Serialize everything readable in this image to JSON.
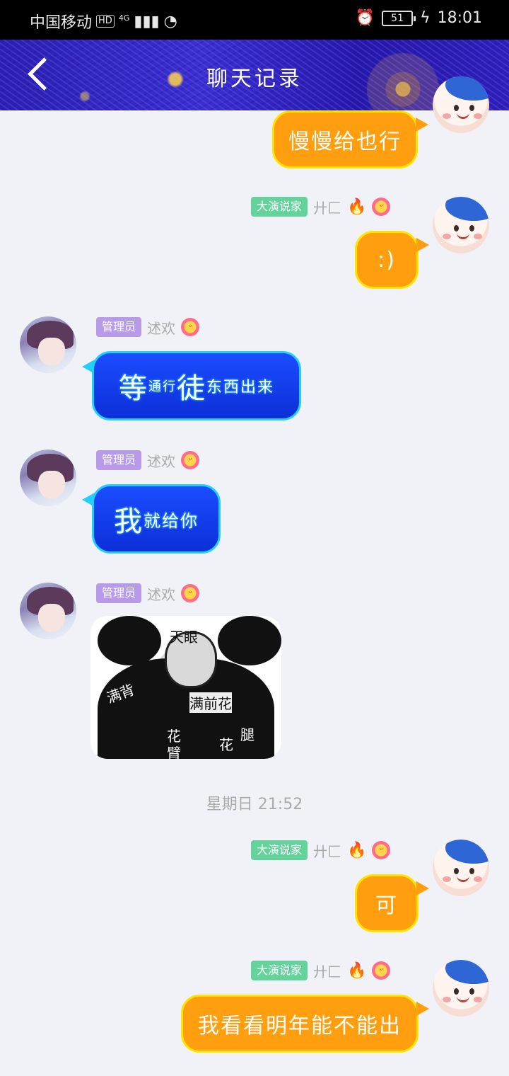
{
  "status_bar": {
    "carrier": "中国移动",
    "hd_badge": "HD",
    "network": "4G",
    "battery": "51",
    "time": "18:01"
  },
  "header": {
    "title": "聊天记录"
  },
  "messages": [
    {
      "sender": "self",
      "text": "慢慢给也行"
    },
    {
      "sender": "self",
      "tag": "大演说家",
      "nick": "廾匚",
      "text": ":)"
    },
    {
      "sender": "other",
      "tag": "管理员",
      "nick": "述欢",
      "text_big1": "等",
      "text_small1": "通行",
      "text_big2": "徒",
      "text_small2": "东西出来"
    },
    {
      "sender": "other",
      "tag": "管理员",
      "nick": "述欢",
      "text_big": "我",
      "text_small": "就给你"
    },
    {
      "sender": "other",
      "tag": "管理员",
      "nick": "述欢",
      "sticker": {
        "top": "天眼",
        "left": "满背",
        "right": "满前花",
        "label1": "花",
        "label2": "臂",
        "label3": "花",
        "label4": "腿"
      }
    },
    {
      "sender": "self",
      "tag": "大演说家",
      "nick": "廾匚",
      "text": "可"
    },
    {
      "sender": "self",
      "tag": "大演说家",
      "nick": "廾匚",
      "text": "我看看明年能不能出"
    }
  ],
  "timestamp": "星期日 21:52",
  "colors": {
    "self_bubble": "#ff9f10",
    "self_border": "#ffe400",
    "other_bubble": "#1b4dff",
    "other_border": "#22d0ff",
    "tag_green": "#63d39b",
    "tag_purple": "#b89be8"
  },
  "icons": {
    "back": "back-arrow-icon",
    "fire": "fire-icon",
    "emoji": "laughing-flower-icon"
  }
}
